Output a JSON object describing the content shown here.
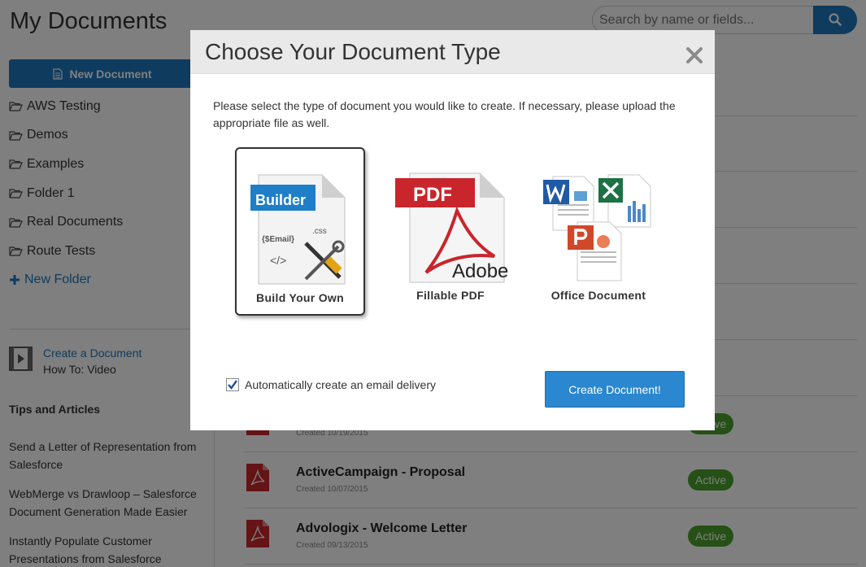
{
  "page": {
    "title": "My Documents",
    "search_placeholder": "Search by name or fields...",
    "new_document_label": "New Document"
  },
  "sidebar": {
    "folders": [
      "AWS Testing",
      "Demos",
      "Examples",
      "Folder 1",
      "Real Documents",
      "Route Tests"
    ],
    "new_folder_label": "New Folder",
    "video_link": "Create a Document",
    "video_subtitle": "How To: Video",
    "tips_heading": "Tips and Articles",
    "tips": [
      "Send a Letter of Representation from Salesforce",
      "WebMerge vs Drawloop – Salesforce Document Generation Made Easier",
      "Instantly Populate Customer Presentations from Salesforce"
    ]
  },
  "documents": [
    {
      "name": "",
      "created": "Created 10/19/2015",
      "status": "Active"
    },
    {
      "name": "ActiveCampaign - Proposal",
      "created": "Created 10/07/2015",
      "status": "Active"
    },
    {
      "name": "Advologix - Welcome Letter",
      "created": "Created 09/13/2015",
      "status": "Active"
    }
  ],
  "modal": {
    "title": "Choose Your Document Type",
    "intro": "Please select the type of document you would like to create. If necessary, please upload the appropriate file as well.",
    "types": [
      {
        "label": "Build Your Own",
        "badge": "Builder",
        "snippets": [
          ".css",
          "{$Email}",
          "</>"
        ],
        "selected": true
      },
      {
        "label": "Fillable PDF",
        "badge": "PDF",
        "brand": "Adobe",
        "selected": false
      },
      {
        "label": "Office Document",
        "selected": false
      }
    ],
    "auto_email_label": "Automatically create an email delivery",
    "auto_email_checked": true,
    "create_button": "Create Document!"
  },
  "colors": {
    "primary_blue": "#1f76bd",
    "button_blue": "#2a87d0",
    "active_green": "#4aa02c",
    "pdf_red": "#c8262c"
  },
  "icons": {
    "search": "search-icon",
    "document": "document-icon",
    "folder": "folder-open-icon",
    "plus": "plus-icon",
    "video": "video-icon",
    "pdf": "pdf-file-icon",
    "close": "close-icon",
    "check": "check-icon"
  }
}
